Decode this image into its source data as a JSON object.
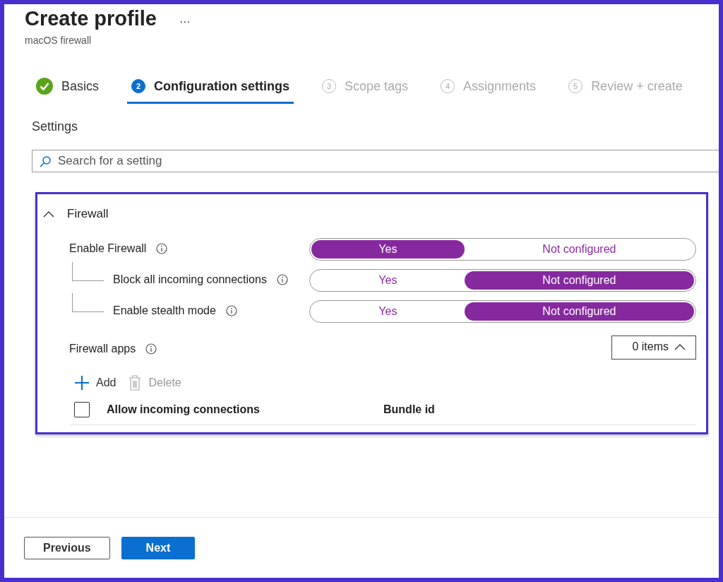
{
  "header": {
    "title": "Create profile",
    "more": "···",
    "subtitle": "macOS firewall"
  },
  "steps": [
    {
      "kind": "done",
      "label": "Basics",
      "selected": false
    },
    {
      "kind": "numbered",
      "number": "2",
      "label": "Configuration settings",
      "selected": true
    },
    {
      "kind": "numbered",
      "number": "3",
      "label": "Scope tags",
      "selected": false
    },
    {
      "kind": "numbered",
      "number": "4",
      "label": "Assignments",
      "selected": false
    },
    {
      "kind": "numbered",
      "number": "5",
      "label": "Review + create",
      "selected": false
    }
  ],
  "settings_heading": "Settings",
  "search": {
    "placeholder": "Search for a setting"
  },
  "group": {
    "title": "Firewall",
    "expanded": true,
    "settings": [
      {
        "label": "Enable Firewall",
        "options": [
          {
            "label": "Yes",
            "selected": true
          },
          {
            "label": "Not configured",
            "selected": false
          }
        ],
        "children": [
          {
            "label": "Block all incoming connections",
            "options": [
              {
                "label": "Yes",
                "selected": false
              },
              {
                "label": "Not configured",
                "selected": true
              }
            ]
          },
          {
            "label": "Enable stealth mode",
            "options": [
              {
                "label": "Yes",
                "selected": false
              },
              {
                "label": "Not configured",
                "selected": true
              }
            ]
          }
        ]
      }
    ],
    "list": {
      "label": "Firewall apps",
      "count": "0 items",
      "expanded": true,
      "actions": [
        {
          "kind": "add",
          "label": "Add",
          "disabled": false
        },
        {
          "kind": "delete",
          "label": "Delete",
          "disabled": true
        }
      ],
      "select_all_checked": false,
      "columns": [
        "Allow incoming connections",
        "Bundle id"
      ]
    }
  },
  "footer": {
    "buttons": [
      {
        "kind": "secondary",
        "label": "Previous"
      },
      {
        "kind": "primary",
        "label": "Next"
      }
    ]
  }
}
